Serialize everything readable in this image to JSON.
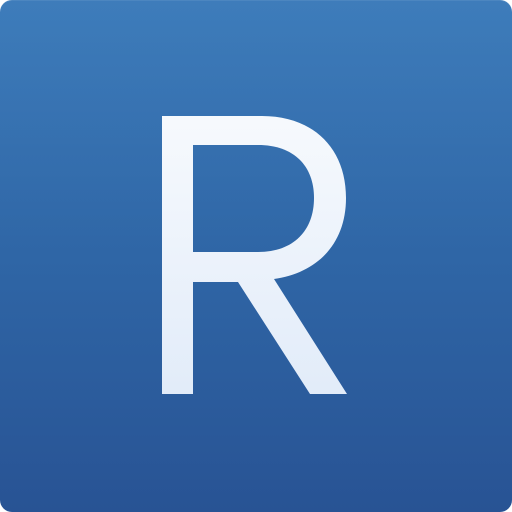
{
  "icon": {
    "letter": "R",
    "colors": {
      "background_top": "#3677b8",
      "background_bottom": "#285394",
      "letter_top": "#ffffff",
      "letter_bottom": "#d9e6f7"
    }
  }
}
